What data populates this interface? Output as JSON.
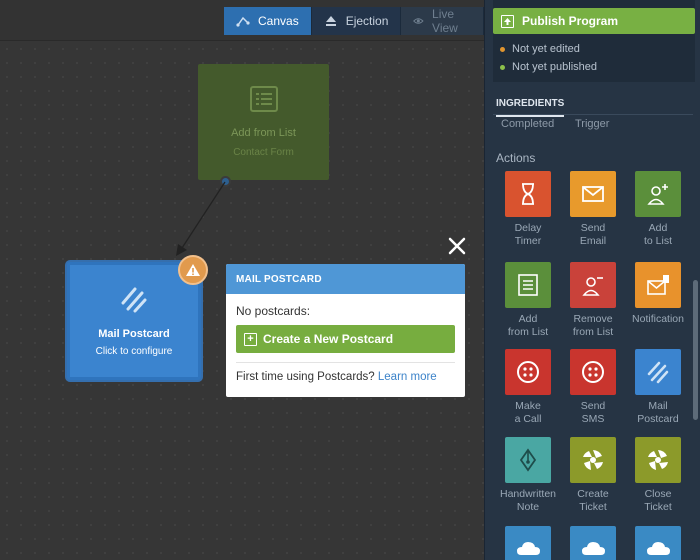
{
  "view_tabs": {
    "canvas": "Canvas",
    "ejection": "Ejection",
    "live_view": "Live View"
  },
  "canvas": {
    "list_node": {
      "title": "Add from List",
      "subtitle": "Contact Form"
    },
    "postcard_node": {
      "title": "Mail Postcard",
      "subtitle": "Click to configure"
    }
  },
  "popup": {
    "header": "MAIL POSTCARD",
    "no_postcards": "No postcards:",
    "create_button": "Create a New Postcard",
    "first_time": "First time using Postcards?",
    "learn_more": "Learn more"
  },
  "panel": {
    "publish_button": "Publish Program",
    "status": [
      {
        "text": "Not yet edited",
        "color": "#e0952f"
      },
      {
        "text": "Not yet published",
        "color": "#8cc04b"
      }
    ],
    "ingredients_tab": "INGREDIENTS",
    "cut_labels": [
      "Completed",
      "Trigger"
    ],
    "actions_title": "Actions",
    "actions": [
      {
        "label": "Delay\nTimer",
        "icon": "hourglass-icon",
        "color": "#d9532f"
      },
      {
        "label": "Send\nEmail",
        "icon": "envelope-icon",
        "color": "#e89a2c"
      },
      {
        "label": "Add\nto List",
        "icon": "add-user-icon",
        "color": "#5b8f3b"
      },
      {
        "label": "Add\nfrom List",
        "icon": "list-icon",
        "color": "#5b8f3b"
      },
      {
        "label": "Remove\nfrom List",
        "icon": "remove-user-icon",
        "color": "#c9423a"
      },
      {
        "label": "Notification",
        "icon": "notification-icon",
        "color": "#e8922c"
      },
      {
        "label": "Make\na Call",
        "icon": "phone-icon",
        "color": "#c9352e"
      },
      {
        "label": "Send\nSMS",
        "icon": "sms-icon",
        "color": "#c9352e"
      },
      {
        "label": "Mail\nPostcard",
        "icon": "postcard-icon",
        "color": "#3b84cf"
      },
      {
        "label": "Handwritten\nNote",
        "icon": "pen-nib-icon",
        "color": "#4aa7a3"
      },
      {
        "label": "Create\nTicket",
        "icon": "zendesk-icon",
        "color": "#8c9a2a"
      },
      {
        "label": "Close\nTicket",
        "icon": "zendesk-icon",
        "color": "#8c9a2a"
      },
      {
        "label": "",
        "icon": "cloud-icon",
        "color": "#3a8ac4"
      },
      {
        "label": "",
        "icon": "cloud-icon",
        "color": "#3a8ac4"
      },
      {
        "label": "",
        "icon": "cloud-icon",
        "color": "#3a8ac4"
      }
    ]
  }
}
